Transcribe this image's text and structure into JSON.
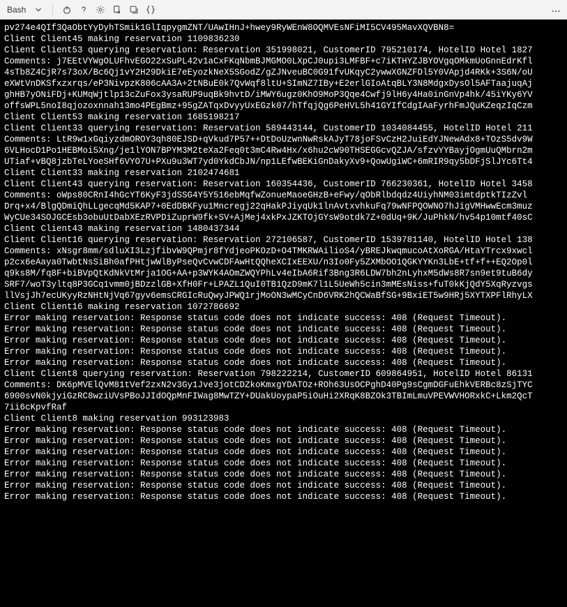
{
  "titlebar": {
    "shell_name": "Bash",
    "icons": {
      "chevron": "▾",
      "power": "⏻",
      "help": "?",
      "settings": "⚙",
      "export": "⇲",
      "new_tab": "⧉",
      "braces": "{}",
      "more": "⋯"
    }
  },
  "terminal": {
    "lines": [
      "pv274e4QIf3QaObtYyDyhTSmik1GlIqpygmZNT/UAwIHnJ+hwey9RyWEnW8OQMVEsNFiMI5CV495MavXQVBN8=",
      "Client Client45 making reservation 1109836230",
      "Client Client53 querying reservation: Reservation 351998021, CustomerID 795210174, HotelID Hotel 1827",
      "Comments: j7EEtVYWgOLUFhvEGO22xSuPL42v1aCxFKqNbmBJMGMO0LXpCJ0upi3LMFBF+c7iKTHYZJBYOVgqOMkmUoGnnEdrKfl",
      "4sTb8Z4CjR7s73oX/Bc6Qj1vY2H29DkiE7eEyozkNeX5SGodZ/gZJNveuBC0G91fvUKqyC2ywwXGNZFDl5Y0VApjd4RKk+3S6N/oU",
      "eXWtVnDKSfxzxrqs/eP3NivpzK806cAA3A+2tNBuE0k7QvWqf8ltU+SImNZ7IBy+E2erlGIoAtqBLY3N8MdgxDysOl5AFTaajuqAj",
      "ghHB7yONiFDj+KUMqWjtlp13cZuFox3ysaRUP9uqBk9hvtD/iMWY6ugz0KhO9MoP3Qqe4Cwfj9lH6y4Ha0inGnVp4hk/45iYKy6YV",
      "offsWPL5noI8qjozoxnnah13mo4PEgBmz+95gZATqxDvyyUxEGzk07/hTfqjQg6PeHVL5h41GYIfCdgIAaFyrhFmJQuKZeqzIqCzm",
      "Client Client53 making reservation 1685198217",
      "Client Client33 querying reservation: Reservation 589443144, CustomerID 1034084455, HotelID Hotel 211",
      "Comments: LtR9w1xGqiyzdmOROY3qh80EJSD+qVkud7P57++DtDoUzwnNwRskAJyT78joFSvCzH2JuiEdYJNewAdx8+TOzS5dv9W",
      "6VLHocD1Po1HEBMoi5Xng/je1lYON7BPYM3M2teXa2Feq0t3mC4Rw4Hx/x6hu2cW90THSEGGcvQZJA/sfzvYYBayjOgmUuQMbrn2m",
      "UTiaf+vBQ8jzbTeLYoeSHf6VYO7U+PXu9u3WT7yd0YkdCbJN/np1LEfwBEKiGnDakyXv9+QowUgiWC+6mRIR9qy5bDFjSlJYc6Tt4",
      "Client Client33 making reservation 2102474681",
      "Client Client43 querying reservation: Reservation 160354436, CustomerID 766230361, HotelID Hotel 3458",
      "Comments: oWps80CRnI4hGcYT6KyF3jdSSG4Y5Y516ebMqfwZonueMaoeGHzB+eFwy/qObRlbdqdz4UiyhNM03imtdptkTIzZvl",
      "Drq+x4/BlgQDmiQhLLgecqMd5KAP7+0EdDBKFyu1Mncregj22qHakPJiyqUk1lnAvtxvhkuFq79wNFPQOWNO7hJigVMHwwEcm3muz",
      "WyCUe34SOJGCEsb3obuUtDabXEzRVPDiZuprW9fk+SV+AjMej4xkPxJZKTOjGYsW9otdk7Z+0dUq+9K/JuPhkN/hv54p10mtf40sC",
      "Client Client43 making reservation 1480437344",
      "Client Client16 querying reservation: Reservation 272106587, CustomerID 1539781140, HotelID Hotel 138",
      "Comments: xNsgr8mm/sdluXI3LzjfibvW9QPmjr8fYdjeoPKOzD+O4TMKRWAilioS4/yBREJkwqmucoAtXoRGA/HtaYTrcx9xwcl",
      "p2cx6eAaya0TwbtNsSiBh0afPHtjwWlByPseQvCvwCDFAwHtQQheXCIxEEXU/n3Io0Fy5ZXMbOO1QGKYYKn3LbE+tf+f++EQ2Op0l",
      "q9ks8M/fq8F+biBVpQtKdNkVtMrja1OG+AA+p3WYK4AOmZWQYPhLv4eIbA6Rif3Bng3R6LDW7bh2nLyhxM5dWs8R7sn9et9tuB6dy",
      "SRF7/woT3yltq8P3GCq1vmm0jBDzzlGB+XfH0Fr+LPAZL1QuI0TB1QzD9mK7l1L5UeWh5cin3mMEsNiss+fuT0kKjQdY5XqRyzvgs",
      "llVsjJh7ecUKyyRzNHtNjVq67gyv6emsCRGIcRuQwyJPWQ1rjMoON3wMCyCnD6VRK2hQCWaBfSG+9BxiET5w9HRj5XYTXPFlRhyLX",
      "Client Client16 making reservation 1072786692",
      "Error making reservation: Response status code does not indicate success: 408 (Request Timeout).",
      "Error making reservation: Response status code does not indicate success: 408 (Request Timeout).",
      "Error making reservation: Response status code does not indicate success: 408 (Request Timeout).",
      "Error making reservation: Response status code does not indicate success: 408 (Request Timeout).",
      "Error making reservation: Response status code does not indicate success: 408 (Request Timeout).",
      "Client Client8 querying reservation: Reservation 798222214, CustomerID 609864951, HotelID Hotel 86131",
      "Comments: DK6pMVElQvM81tVef2zxN2v3Gy1Jve3jotCDZkoKmxgYDATOz+ROh63UsOCPghD40Pg9sCgmDGFuEhkVERBc8zSjTYC",
      "6900svN0kjyiGzRC8wziUVsPBoJJIdOQpMnFIWag8MwTZY+DUakUoypaP5iOuHi2XRqK8BZOk3TBImLmuVPEVWVHORxkC+Lkm2QcT",
      "7ii6cKpvfRaf",
      "Client Client8 making reservation 993123983",
      "Error making reservation: Response status code does not indicate success: 408 (Request Timeout).",
      "Error making reservation: Response status code does not indicate success: 408 (Request Timeout).",
      "Error making reservation: Response status code does not indicate success: 408 (Request Timeout).",
      "Error making reservation: Response status code does not indicate success: 408 (Request Timeout).",
      "Error making reservation: Response status code does not indicate success: 408 (Request Timeout).",
      "Error making reservation: Response status code does not indicate success: 408 (Request Timeout).",
      "Error making reservation: Response status code does not indicate success: 408 (Request Timeout)."
    ]
  }
}
